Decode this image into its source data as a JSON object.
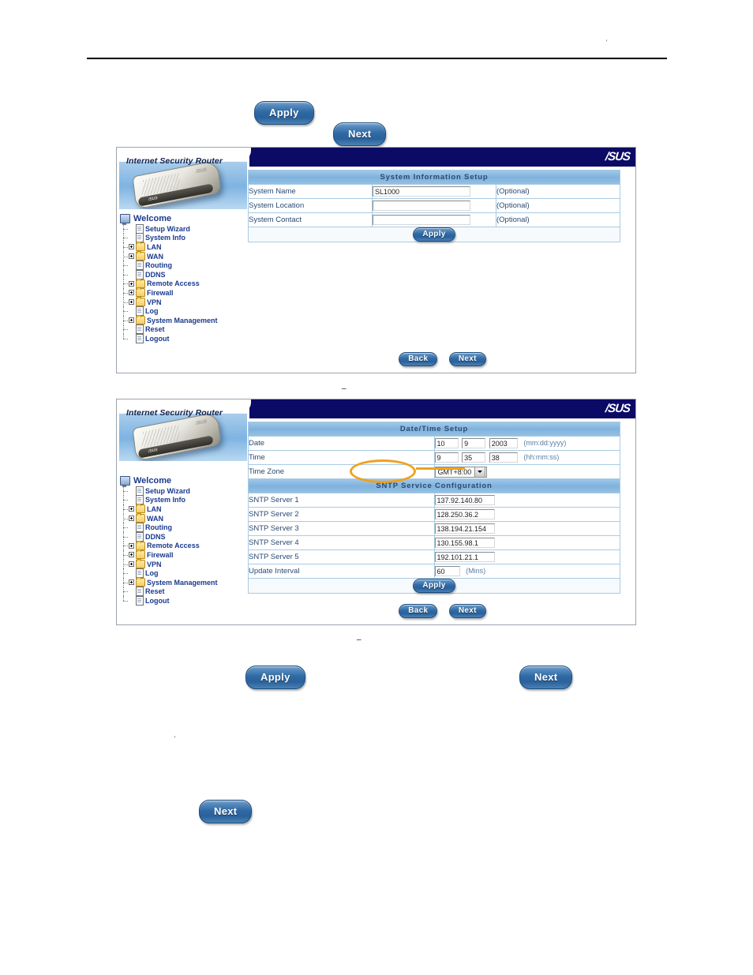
{
  "document": {
    "header_mark": "'",
    "separator_mark_1": "_",
    "separator_mark_2": "_",
    "body_mark": "'"
  },
  "standalone_buttons": {
    "apply_top": "Apply",
    "next_top": "Next",
    "apply_mid": "Apply",
    "next_mid": "Next",
    "next_bottom": "Next"
  },
  "router_ui": {
    "brand": "/SUS",
    "banner_title": "Internet Security Router",
    "nav": {
      "root_label": "Welcome",
      "root_icon": "monitor-icon",
      "items": [
        {
          "label": "Setup Wizard",
          "icon": "document-icon",
          "expandable": false
        },
        {
          "label": "System Info",
          "icon": "document-icon",
          "expandable": false
        },
        {
          "label": "LAN",
          "icon": "folder-icon",
          "expandable": true
        },
        {
          "label": "WAN",
          "icon": "folder-icon",
          "expandable": true
        },
        {
          "label": "Routing",
          "icon": "document-icon",
          "expandable": false
        },
        {
          "label": "DDNS",
          "icon": "document-icon",
          "expandable": false
        },
        {
          "label": "Remote Access",
          "icon": "folder-icon",
          "expandable": true
        },
        {
          "label": "Firewall",
          "icon": "folder-icon",
          "expandable": true
        },
        {
          "label": "VPN",
          "icon": "folder-icon",
          "expandable": true
        },
        {
          "label": "Log",
          "icon": "document-icon",
          "expandable": false
        },
        {
          "label": "System Management",
          "icon": "folder-icon",
          "expandable": true
        },
        {
          "label": "Reset",
          "icon": "document-icon",
          "expandable": false
        },
        {
          "label": "Logout",
          "icon": "document-icon",
          "expandable": false
        }
      ]
    },
    "footer": {
      "back": "Back",
      "next": "Next"
    }
  },
  "panel_system_info": {
    "section_title": "System Information Setup",
    "rows": [
      {
        "label": "System Name",
        "value": "SL1000",
        "hint": "(Optional)"
      },
      {
        "label": "System Location",
        "value": "",
        "hint": "(Optional)"
      },
      {
        "label": "System Contact",
        "value": "",
        "hint": "(Optional)"
      }
    ],
    "apply_label": "Apply"
  },
  "panel_datetime": {
    "section_title": "Date/Time Setup",
    "date": {
      "label": "Date",
      "month": "10",
      "day": "9",
      "year": "2003",
      "format_hint": "(mm:dd:yyyy)"
    },
    "time": {
      "label": "Time",
      "hour": "9",
      "minute": "35",
      "second": "38",
      "format_hint": "(hh:mm:ss)"
    },
    "timezone": {
      "label": "Time Zone",
      "selected": "GMT+8:00"
    },
    "sntp_section_title": "SNTP Service Configuration",
    "sntp_servers": [
      {
        "label": "SNTP Server 1",
        "value": "137.92.140.80"
      },
      {
        "label": "SNTP Server 2",
        "value": "128.250.36.2"
      },
      {
        "label": "SNTP Server 3",
        "value": "138.194.21.154"
      },
      {
        "label": "SNTP Server 4",
        "value": "130.155.98.1"
      },
      {
        "label": "SNTP Server 5",
        "value": "192.101.21.1"
      }
    ],
    "update_interval": {
      "label": "Update Interval",
      "value": "60",
      "unit_hint": "(Mins)"
    },
    "apply_label": "Apply",
    "highlight_color": "#f0a11e"
  }
}
